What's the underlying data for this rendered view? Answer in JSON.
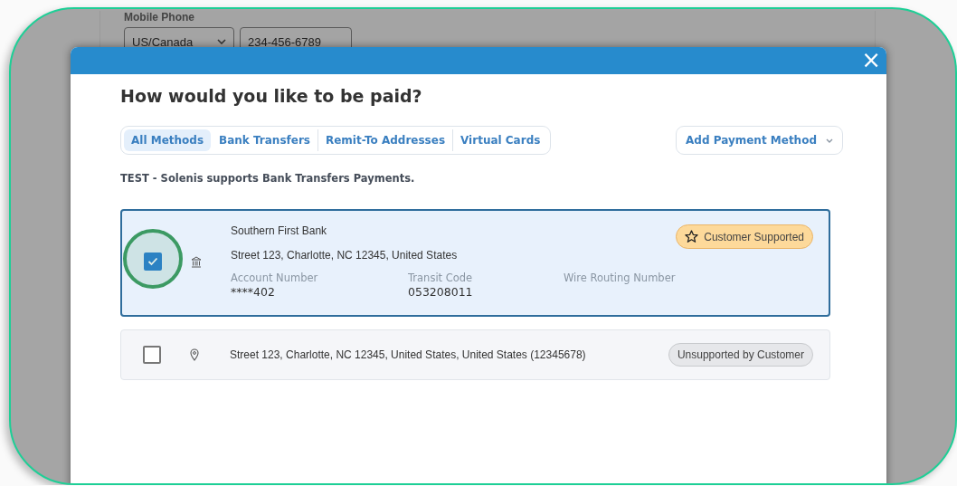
{
  "background_form": {
    "label": "Mobile Phone",
    "country_select": {
      "value": "US/Canada"
    },
    "phone_field": {
      "value": "234-456-6789"
    }
  },
  "modal": {
    "close": "×",
    "title": "How would you like to be paid?",
    "tabs": [
      {
        "label": "All Methods",
        "selected": true
      },
      {
        "label": "Bank Transfers",
        "selected": false
      },
      {
        "label": "Remit-To Addresses",
        "selected": false
      },
      {
        "label": "Virtual Cards",
        "selected": false
      }
    ],
    "add_button": {
      "label": "Add Payment Method"
    },
    "notice": "TEST - Solenis supports Bank Transfers Payments.",
    "methods": [
      {
        "kind": "bank",
        "selected": true,
        "highlighted": true,
        "name": "Southern First Bank",
        "address": "Street 123, Charlotte, NC 12345, United States",
        "fields": [
          {
            "label": "Account Number",
            "value": "****402"
          },
          {
            "label": "Transit Code",
            "value": "053208011"
          },
          {
            "label": "Wire Routing Number"
          }
        ],
        "badge": {
          "kind": "supported",
          "label": "Customer Supported"
        }
      },
      {
        "kind": "address",
        "selected": false,
        "highlighted": false,
        "address": "Street 123, Charlotte, NC 12345, United States, United States (12345678)",
        "badge": {
          "kind": "unsupported",
          "label": "Unsupported by Customer"
        }
      }
    ]
  }
}
